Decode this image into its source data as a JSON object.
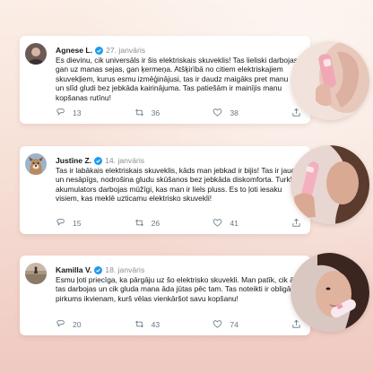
{
  "tweets": [
    {
      "name": "Agnese L.",
      "date": "27. janvāris",
      "text": "Es dievinu, cik universāls ir šis elektriskais skuveklis! Tas lieliski darbojas gan uz manas sejas, gan ķermeņa. Atšķirībā no citiem elektriskajiem skuvekļiem, kurus esmu izmēģinājusi, tas ir daudz maigāks pret manu ādu un slīd gludi bez jebkāda kairinājuma. Tas patiešām ir mainījis manu kopšanas rutīnu!",
      "replies": "13",
      "retweets": "36",
      "likes": "38",
      "avatar_icon": "user-photo"
    },
    {
      "name": "Justīne Z.",
      "date": "14. janvāris",
      "text": "Tas ir labākais elektriskais skuveklis, kāds man jebkad ir bijis! Tas ir jaudīgs un nesāpīgs, nodrošina gludu skūšanos bez jebkāda diskomforta. Turklāt akumulators darbojas mūžīgi, kas man ir liels pluss. Es to ļoti iesaku visiem, kas meklē uzticamu elektrisko skuvekli!",
      "replies": "15",
      "retweets": "26",
      "likes": "41",
      "avatar_icon": "dog-photo"
    },
    {
      "name": "Kamilla V.",
      "date": "18. janvāris",
      "text": "Esmu ļoti priecīga, ka pārgāju uz šo elektrisko skuvekli. Man patīk, cik ātri tas darbojas un cik gluda mana āda jūtas pēc tam. Tas noteikti ir obligāts pirkums ikvienam, kurš vēlas vienkāršot savu kopšanu!",
      "replies": "20",
      "retweets": "43",
      "likes": "74",
      "avatar_icon": "landscape-photo"
    }
  ],
  "colors": {
    "verified": "#1d9bf0",
    "name": "#14171a",
    "meta": "#8a8f95",
    "action": "#657786"
  },
  "icons": [
    "reply-icon",
    "retweet-icon",
    "like-icon",
    "share-icon",
    "verified-icon"
  ]
}
